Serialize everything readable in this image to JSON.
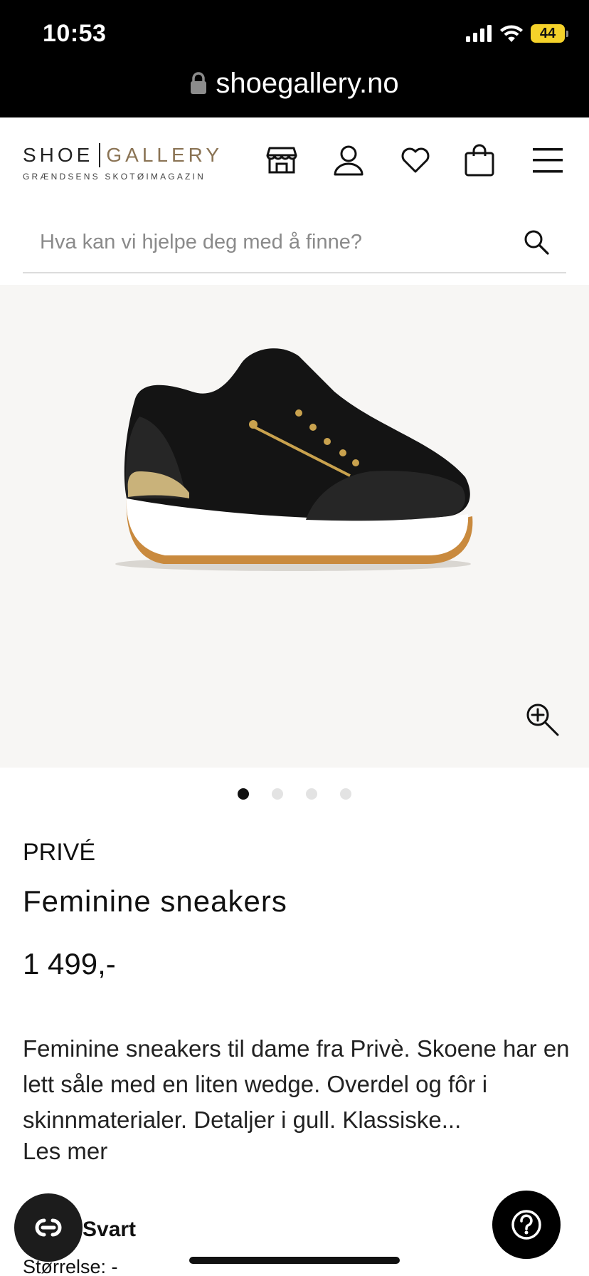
{
  "status_bar": {
    "time": "10:53",
    "battery": "44"
  },
  "browser": {
    "url": "shoegallery.no"
  },
  "header": {
    "logo_shoe": "SHOE",
    "logo_gallery": "GALLERY",
    "logo_tagline": "GRÆNDSENS SKOTØIMAGAZIN",
    "icons": [
      "store-icon",
      "user-icon",
      "heart-icon",
      "bag-icon",
      "menu-icon"
    ]
  },
  "search": {
    "placeholder": "Hva kan vi hjelpe deg med å finne?"
  },
  "gallery": {
    "image_count": 4,
    "active_index": 0
  },
  "product": {
    "brand": "PRIVÉ",
    "title": "Feminine sneakers",
    "price": "1 499,-",
    "description": "Feminine sneakers til dame fra Privè. Skoene har en lett såle med en liten wedge. Overdel og fôr i skinnmaterialer. Detaljer i gull. Klassiske...",
    "read_more": "Les mer",
    "color": "Svart",
    "size_label": "Størrelse: -"
  },
  "colors": {
    "accent": "#8a7354",
    "battery": "#f5d22a",
    "image_bg": "#f7f6f4"
  }
}
